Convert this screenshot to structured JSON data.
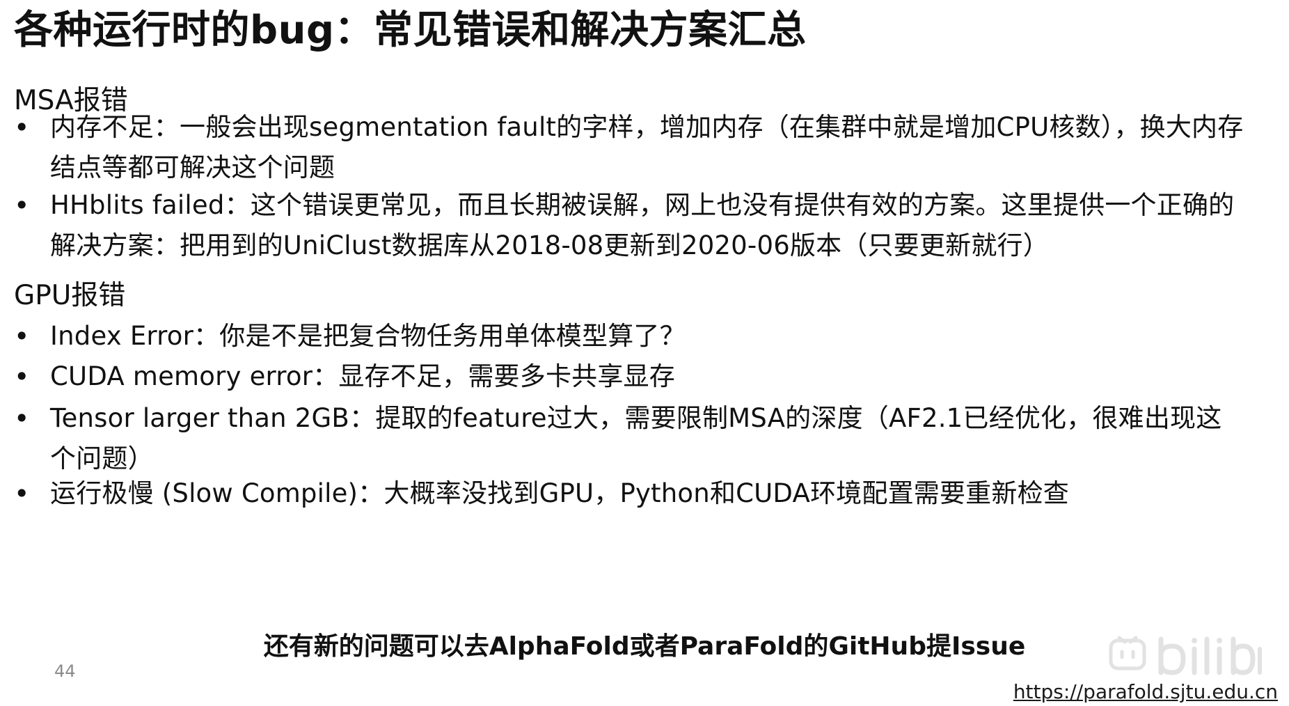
{
  "title": "各种运行时的bug：常见错误和解决方案汇总",
  "sections": [
    {
      "heading": "MSA报错",
      "items": [
        "内存不足：一般会出现segmentation fault的字样，增加内存（在集群中就是增加CPU核数），换大内存结点等都可解决这个问题",
        "HHblits failed：这个错误更常见，而且长期被误解，网上也没有提供有效的方案。这里提供一个正确的解决方案：把用到的UniClust数据库从2018-08更新到2020-06版本（只要更新就行）"
      ]
    },
    {
      "heading": "GPU报错",
      "items": [
        "Index Error：你是不是把复合物任务用单体模型算了？",
        "CUDA memory error：显存不足，需要多卡共享显存",
        "Tensor larger than 2GB：提取的feature过大，需要限制MSA的深度（AF2.1已经优化，很难出现这个问题）",
        "运行极慢 (Slow Compile)：大概率没找到GPU，Python和CUDA环境配置需要重新检查"
      ]
    }
  ],
  "bullet_symbol": "•",
  "footer_note": "还有新的问题可以去AlphaFold或者ParaFold的GitHub提Issue",
  "page_number": "44",
  "site_link": "https://parafold.sjtu.edu.cn",
  "watermark": {
    "icon": "bilibili-logo-icon"
  }
}
